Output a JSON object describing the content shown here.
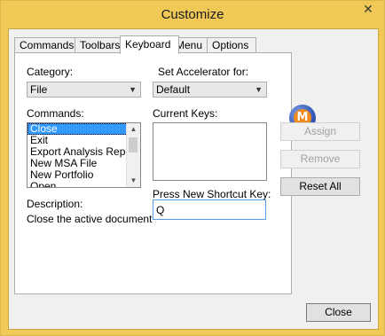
{
  "window": {
    "title": "Customize",
    "close_glyph": "✕"
  },
  "tabs": [
    {
      "label": "Commands"
    },
    {
      "label": "Toolbars"
    },
    {
      "label": "Keyboard"
    },
    {
      "label": "Menu"
    },
    {
      "label": "Options"
    }
  ],
  "active_tab": "Keyboard",
  "keyboard": {
    "category_label": "Category:",
    "category_value": "File",
    "accelerator_label": "Set Accelerator for:",
    "accelerator_value": "Default",
    "commands_label": "Commands:",
    "commands": [
      "Close",
      "Exit",
      "Export Analysis Report",
      "New MSA File",
      "New Portfolio",
      "Open"
    ],
    "selected_command": "Close",
    "current_keys_label": "Current Keys:",
    "new_shortcut_label": "Press New Shortcut Key:",
    "new_shortcut_value": "Q",
    "description_label": "Description:",
    "description_text": "Close the active document"
  },
  "buttons": {
    "assign": "Assign",
    "remove": "Remove",
    "reset_all": "Reset All",
    "close": "Close"
  },
  "logo": {
    "letter": "M",
    "icon": "app-logo-icon"
  },
  "colors": {
    "frame": "#f0c957",
    "selection": "#3399ff"
  }
}
